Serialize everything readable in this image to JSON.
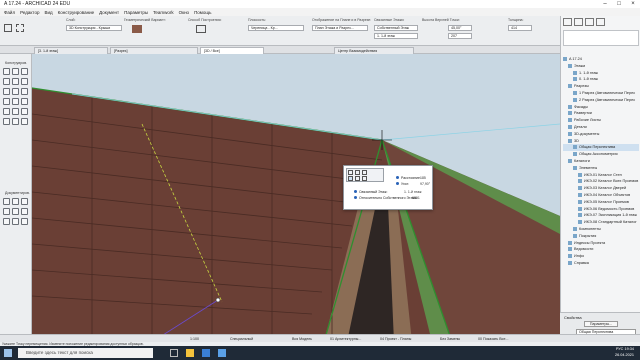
{
  "app": {
    "title": "A 17.24 - ARCHICAD 24 EDU"
  },
  "menu": [
    "Файл",
    "Редактор",
    "Вид",
    "Конструирование",
    "Документ",
    "Параметры",
    "Teamwork",
    "Окно",
    "Помощь"
  ],
  "infobox": {
    "groups": [
      "Слой:",
      "Геометрический Вариант:",
      "Способ Построения:",
      "Плоскость:",
      "Отображение на Плане и в Разрезе:",
      "Связанные Этажи:",
      "Высота Верхней Точки:",
      "Толщина:"
    ],
    "fields": [
      "3D Конструкция - Крыши",
      "Черепица - Кр...",
      "План Этажа и Разрез...",
      "Собственный Этаж",
      "1. 1-й этаж",
      "45,00°",
      "207",
      "414"
    ]
  },
  "tabs": [
    "[3. 1-й этаж]",
    "[Разрез]",
    "[3D / Все]",
    "Центр Взаимодействия"
  ],
  "toolbox": {
    "sections": [
      "Конструиров.",
      "Документиров."
    ]
  },
  "palette": {
    "rows": [
      {
        "label": "Расстояние:",
        "value": "185"
      },
      {
        "label": "Угол:",
        "value": "97,90°"
      },
      {
        "label": "Связанный Этаж:",
        "value": "1. 1-й этаж"
      },
      {
        "label": "Относительно Собственного Этажа:",
        "value": "9801"
      }
    ]
  },
  "navigator": {
    "items": [
      {
        "label": "A 17.24",
        "level": 0
      },
      {
        "label": "Этажи",
        "level": 1
      },
      {
        "label": "1. 1-й этаж",
        "level": 2
      },
      {
        "label": "0. 1-й этаж",
        "level": 2
      },
      {
        "label": "Разрезы",
        "level": 1
      },
      {
        "label": "1 Разрез (Автоматически Перес",
        "level": 2
      },
      {
        "label": "2 Разрез (Автоматически Перес",
        "level": 2
      },
      {
        "label": "Фасады",
        "level": 1
      },
      {
        "label": "Развертки",
        "level": 1
      },
      {
        "label": "Рабочие Листы",
        "level": 1
      },
      {
        "label": "Детали",
        "level": 1
      },
      {
        "label": "3D-документы",
        "level": 1
      },
      {
        "label": "3D",
        "level": 1
      },
      {
        "label": "Общая Перспектива",
        "level": 2,
        "selected": true
      },
      {
        "label": "Общая Аксонометрия",
        "level": 2
      },
      {
        "label": "Каталоги",
        "level": 1
      },
      {
        "label": "Элементы",
        "level": 2
      },
      {
        "label": "ИКЭ-01 Каталог Стен",
        "level": 3
      },
      {
        "label": "ИКЭ-02 Каталог Всех Проемов",
        "level": 3
      },
      {
        "label": "ИКЭ-03 Каталог Дверей",
        "level": 3
      },
      {
        "label": "ИКЭ-04 Каталог Объектов",
        "level": 3
      },
      {
        "label": "ИКЭ-05 Каталог Проемов",
        "level": 3
      },
      {
        "label": "ИКЭ-06 Ведомость Проемов",
        "level": 3
      },
      {
        "label": "ИКЭ-07 Экспликация 1-й этаж",
        "level": 3
      },
      {
        "label": "ИКЭ-08 Стандартный Каталог",
        "level": 3
      },
      {
        "label": "Компоненты",
        "level": 2
      },
      {
        "label": "Покрытия",
        "level": 2
      },
      {
        "label": "Индексы Проекта",
        "level": 1
      },
      {
        "label": "Ведомости",
        "level": 1
      },
      {
        "label": "Инфо",
        "level": 1
      },
      {
        "label": "Справка",
        "level": 1
      }
    ]
  },
  "properties": {
    "title": "Свойства",
    "button": "Параметры...",
    "view": "Общая Перспектива"
  },
  "statusbar": [
    "1:100",
    "Специальный",
    "Вся Модель",
    "01 Архитектурны...",
    "04 Проект - Планы",
    "Без Замены",
    "00 Показать Все..."
  ],
  "hint": "Укажите Точку перемещения. Измените положение редактирования доступных образцов.",
  "taskbar": {
    "search": "Введите здесь текст для поиска",
    "time": "19:34",
    "date": "26.04.2021",
    "lang": "РУС"
  },
  "colors": {
    "roof": "#6a3f35",
    "accent": "#2f8f2f",
    "sky": "#c8d7e2",
    "ground": "#5f8d4a"
  }
}
